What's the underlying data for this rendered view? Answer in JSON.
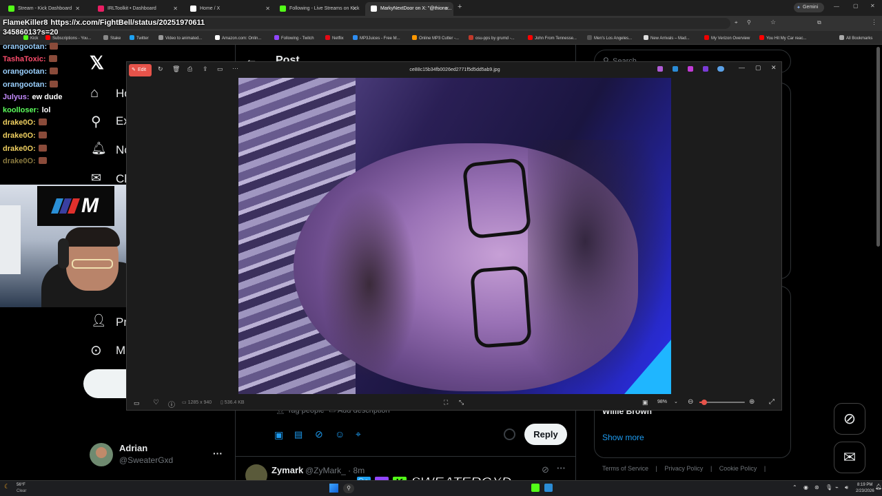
{
  "tabs": [
    {
      "label": "Stream - Kick Dashboard",
      "color": "#53fc18"
    },
    {
      "label": "IRLToolkit • Dashboard",
      "color": "#e91e63"
    },
    {
      "label": "Home / X",
      "color": "#ffffff"
    },
    {
      "label": "Following - Live Streams on Kick",
      "color": "#53fc18"
    },
    {
      "label": "MarkyNextDoor on X: \"@thiono...",
      "color": "#ffffff"
    }
  ],
  "gemini_label": "Gemini",
  "address_url": "https://x.com/FightBell/status/2025197061134586013?s=20",
  "bookmarks": [
    "Kick",
    "Subscriptions - You...",
    "Stake",
    "Twitter",
    "Video to animated...",
    "Amazon.com: Onlin...",
    "Following - Twitch",
    "Netflix",
    "MP3Juices - Free M...",
    "Online MP3 Cutter -...",
    "osu-pps by grumd -...",
    "John From Tennesse...",
    "Men's Los Angeles...",
    "New Arrivals – Mad...",
    "My Verizon Overview",
    "You Hit My Car reac...",
    "All Bookmarks"
  ],
  "overlay_chat": [
    {
      "user": "FlameKiller8",
      "msg": "https://x.com/FightBell/status/20251970611",
      "color": "#ffffff"
    },
    {
      "user": "",
      "msg": "34586013?s=20",
      "color": "#ffffff"
    },
    {
      "user": "orangootan:",
      "msg": "",
      "color": "#9ad0ff",
      "emote": true
    },
    {
      "user": "TashaToxic:",
      "msg": "",
      "color": "#ff4d6d",
      "emote": true
    },
    {
      "user": "orangootan:",
      "msg": "",
      "color": "#9ad0ff",
      "emote": true
    },
    {
      "user": "orangootan:",
      "msg": "",
      "color": "#9ad0ff",
      "emote": true
    },
    {
      "user": "Julyus:",
      "msg": "ew dude",
      "color": "#c58bff"
    },
    {
      "user": "koolloser:",
      "msg": "lol",
      "color": "#5cff5c"
    },
    {
      "user": "drake0O:",
      "msg": "",
      "color": "#f0d060",
      "emote": true
    },
    {
      "user": "drake0O:",
      "msg": "",
      "color": "#f0d060",
      "emote": true
    },
    {
      "user": "drake0O:",
      "msg": "",
      "color": "#f0d060",
      "emote": true
    },
    {
      "user": "drake0O:",
      "msg": "",
      "color": "#8a7a40",
      "emote": true
    }
  ],
  "x": {
    "post_header": "Post",
    "search_placeholder": "Search",
    "nav": [
      "Home",
      "Explore",
      "Notifications",
      "Chat",
      "Profile",
      "More"
    ],
    "nav_short": [
      "Ho",
      "Ex",
      "No",
      "Ch",
      "Pr",
      "M"
    ],
    "account_name": "Adrian",
    "account_handle": "@SweaterGxd",
    "tag_people": "Tag people",
    "add_description": "Add description",
    "reply_button": "Reply",
    "reply_user": "Zymark",
    "reply_handle": "@ZyMark_ · 8m",
    "right_name": "Willie Brown",
    "show_more": "Show more",
    "footer": [
      "Terms of Service",
      "Privacy Policy",
      "Cookie Policy"
    ]
  },
  "viewer": {
    "edit_label": "Edit",
    "filename": "ce88c15b34fb0026ed2771f5d5dd5ab9.jpg",
    "dims": "1285 x 940",
    "size": "536.4 KB",
    "zoom": "98%",
    "zoom_level": 0.1
  },
  "stream_banner": "SWEATERGXD",
  "taskbar": {
    "weather_temp": "56°F",
    "weather_desc": "Clear",
    "time": "8:19 PM",
    "date": "2/23/2026"
  }
}
